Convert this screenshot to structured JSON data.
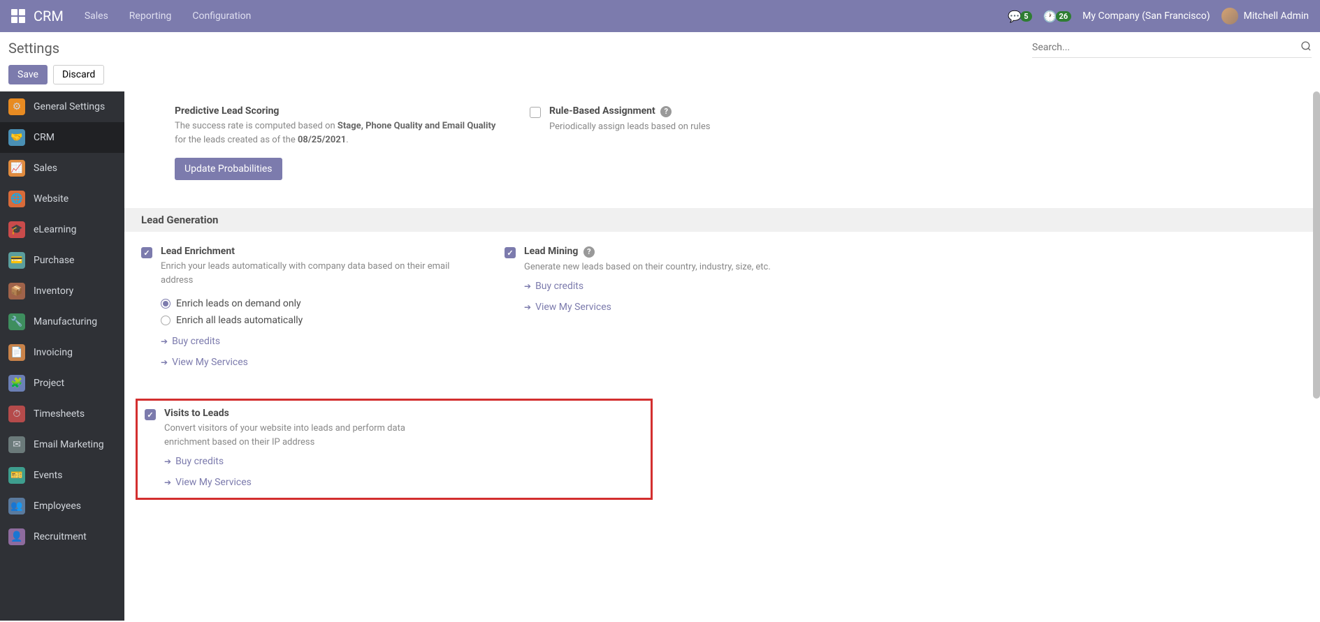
{
  "nav": {
    "brand": "CRM",
    "menu": [
      "Sales",
      "Reporting",
      "Configuration"
    ],
    "badge_chat": "5",
    "badge_clock": "26",
    "company": "My Company (San Francisco)",
    "user": "Mitchell Admin"
  },
  "header": {
    "title": "Settings",
    "search_placeholder": "Search..."
  },
  "actions": {
    "save": "Save",
    "discard": "Discard"
  },
  "sidebar": {
    "items": [
      {
        "label": "General Settings",
        "icon": "⚙",
        "bg": "#e88b22"
      },
      {
        "label": "CRM",
        "icon": "💼",
        "bg": "#4a90b5"
      },
      {
        "label": "Sales",
        "icon": "📈",
        "bg": "#e08b3e"
      },
      {
        "label": "Website",
        "icon": "🌐",
        "bg": "#d86b3a"
      },
      {
        "label": "eLearning",
        "icon": "🎓",
        "bg": "#c94b4b"
      },
      {
        "label": "Purchase",
        "icon": "💳",
        "bg": "#5a9e9e"
      },
      {
        "label": "Inventory",
        "icon": "📦",
        "bg": "#a0634a"
      },
      {
        "label": "Manufacturing",
        "icon": "🔧",
        "bg": "#3e8e5e"
      },
      {
        "label": "Invoicing",
        "icon": "📄",
        "bg": "#c9834a"
      },
      {
        "label": "Project",
        "icon": "🧩",
        "bg": "#6b7fb5"
      },
      {
        "label": "Timesheets",
        "icon": "⏱",
        "bg": "#b54b4b"
      },
      {
        "label": "Email Marketing",
        "icon": "✉",
        "bg": "#6b7a7a"
      },
      {
        "label": "Events",
        "icon": "🎫",
        "bg": "#3e9e8e"
      },
      {
        "label": "Employees",
        "icon": "👥",
        "bg": "#5a7a9e"
      },
      {
        "label": "Recruitment",
        "icon": "👤",
        "bg": "#8e6b9e"
      }
    ]
  },
  "settings": {
    "predictive": {
      "title": "Predictive Lead Scoring",
      "desc_prefix": "The success rate is computed based on ",
      "desc_bold1": "Stage, Phone Quality and Email Quality",
      "desc_mid": " for the leads created as of the ",
      "desc_bold2": "08/25/2021",
      "desc_suffix": ".",
      "button": "Update Probabilities"
    },
    "rule_assign": {
      "title": "Rule-Based Assignment",
      "desc": "Periodically assign leads based on rules"
    },
    "section_header": "Lead Generation",
    "lead_enrich": {
      "title": "Lead Enrichment",
      "desc": "Enrich your leads automatically with company data based on their email address",
      "radio1": "Enrich leads on demand only",
      "radio2": "Enrich all leads automatically",
      "link1": "Buy credits",
      "link2": "View My Services"
    },
    "lead_mining": {
      "title": "Lead Mining",
      "desc": "Generate new leads based on their country, industry, size, etc.",
      "link1": "Buy credits",
      "link2": "View My Services"
    },
    "visits_leads": {
      "title": "Visits to Leads",
      "desc": "Convert visitors of your website into leads and perform data enrichment based on their IP address",
      "link1": "Buy credits",
      "link2": "View My Services"
    }
  }
}
